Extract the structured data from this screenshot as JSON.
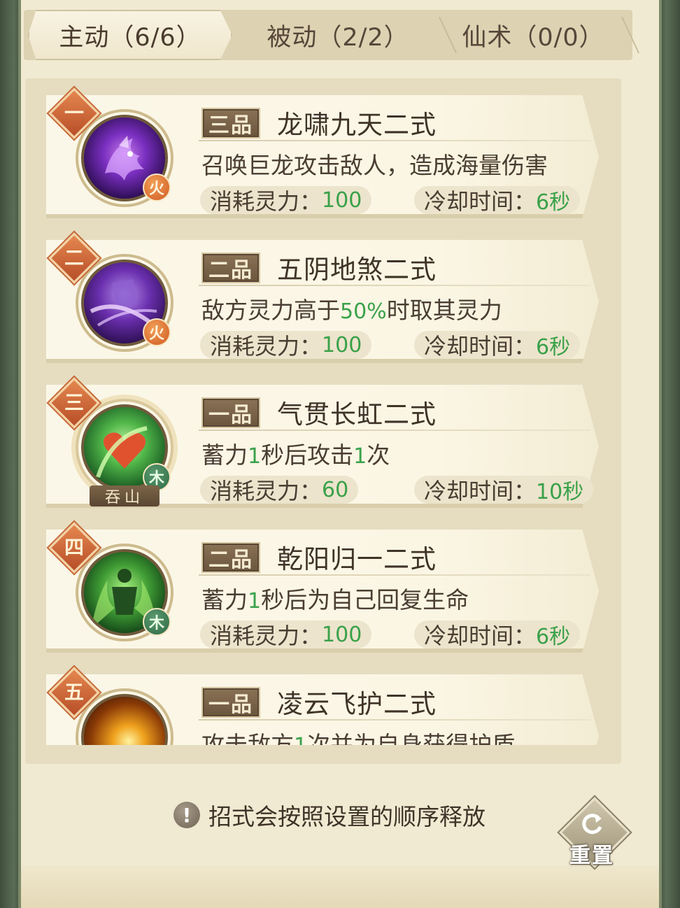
{
  "tabs": [
    {
      "label": "主动（6/6）",
      "active": true
    },
    {
      "label": "被动（2/2）",
      "active": false
    },
    {
      "label": "仙术（0/0）",
      "active": false
    }
  ],
  "skills": [
    {
      "order": "一",
      "grade": "三品",
      "name": "龙啸九天二式",
      "desc_parts": [
        "召唤巨龙攻击敌人，造成海量伤害"
      ],
      "cost_label": "消耗灵力：",
      "cost_value": "100",
      "cd_label": "冷却时间：",
      "cd_value": "6秒",
      "element": "火",
      "element_type": "fire",
      "icon": "purple-dragon-icon"
    },
    {
      "order": "二",
      "grade": "二品",
      "name": "五阴地煞二式",
      "desc_parts": [
        "敌方灵力高于",
        "50%",
        "时取其灵力"
      ],
      "cost_label": "消耗灵力：",
      "cost_value": "100",
      "cd_label": "冷却时间：",
      "cd_value": "6秒",
      "element": "火",
      "element_type": "fire",
      "icon": "purple-swirl-icon"
    },
    {
      "order": "三",
      "grade": "一品",
      "name": "气贯长虹二式",
      "desc_parts": [
        "蓄力",
        "1",
        "秒后攻击",
        "1",
        "次"
      ],
      "cost_label": "消耗灵力：",
      "cost_value": "60",
      "cd_label": "冷却时间：",
      "cd_value": "10秒",
      "element": "木",
      "element_type": "wood",
      "icon": "green-heart-icon",
      "sect": "吞山"
    },
    {
      "order": "四",
      "grade": "二品",
      "name": "乾阳归一二式",
      "desc_parts": [
        "蓄力",
        "1",
        "秒后为自己回复生命"
      ],
      "cost_label": "消耗灵力：",
      "cost_value": "100",
      "cd_label": "冷却时间：",
      "cd_value": "6秒",
      "element": "木",
      "element_type": "wood",
      "icon": "green-figure-icon"
    },
    {
      "order": "五",
      "grade": "一品",
      "name": "凌云飞护二式",
      "desc_parts": [
        "攻击敌方",
        "1",
        "次并为自身获得护盾"
      ],
      "icon": "golden-orb-icon"
    }
  ],
  "footer": {
    "tip_icon": "!",
    "tip": "招式会按照设置的顺序释放",
    "reset_label": "重置"
  },
  "colors": {
    "highlight": "#3aa14a",
    "panel": "#f1ead2",
    "badge": "#c9602f"
  }
}
